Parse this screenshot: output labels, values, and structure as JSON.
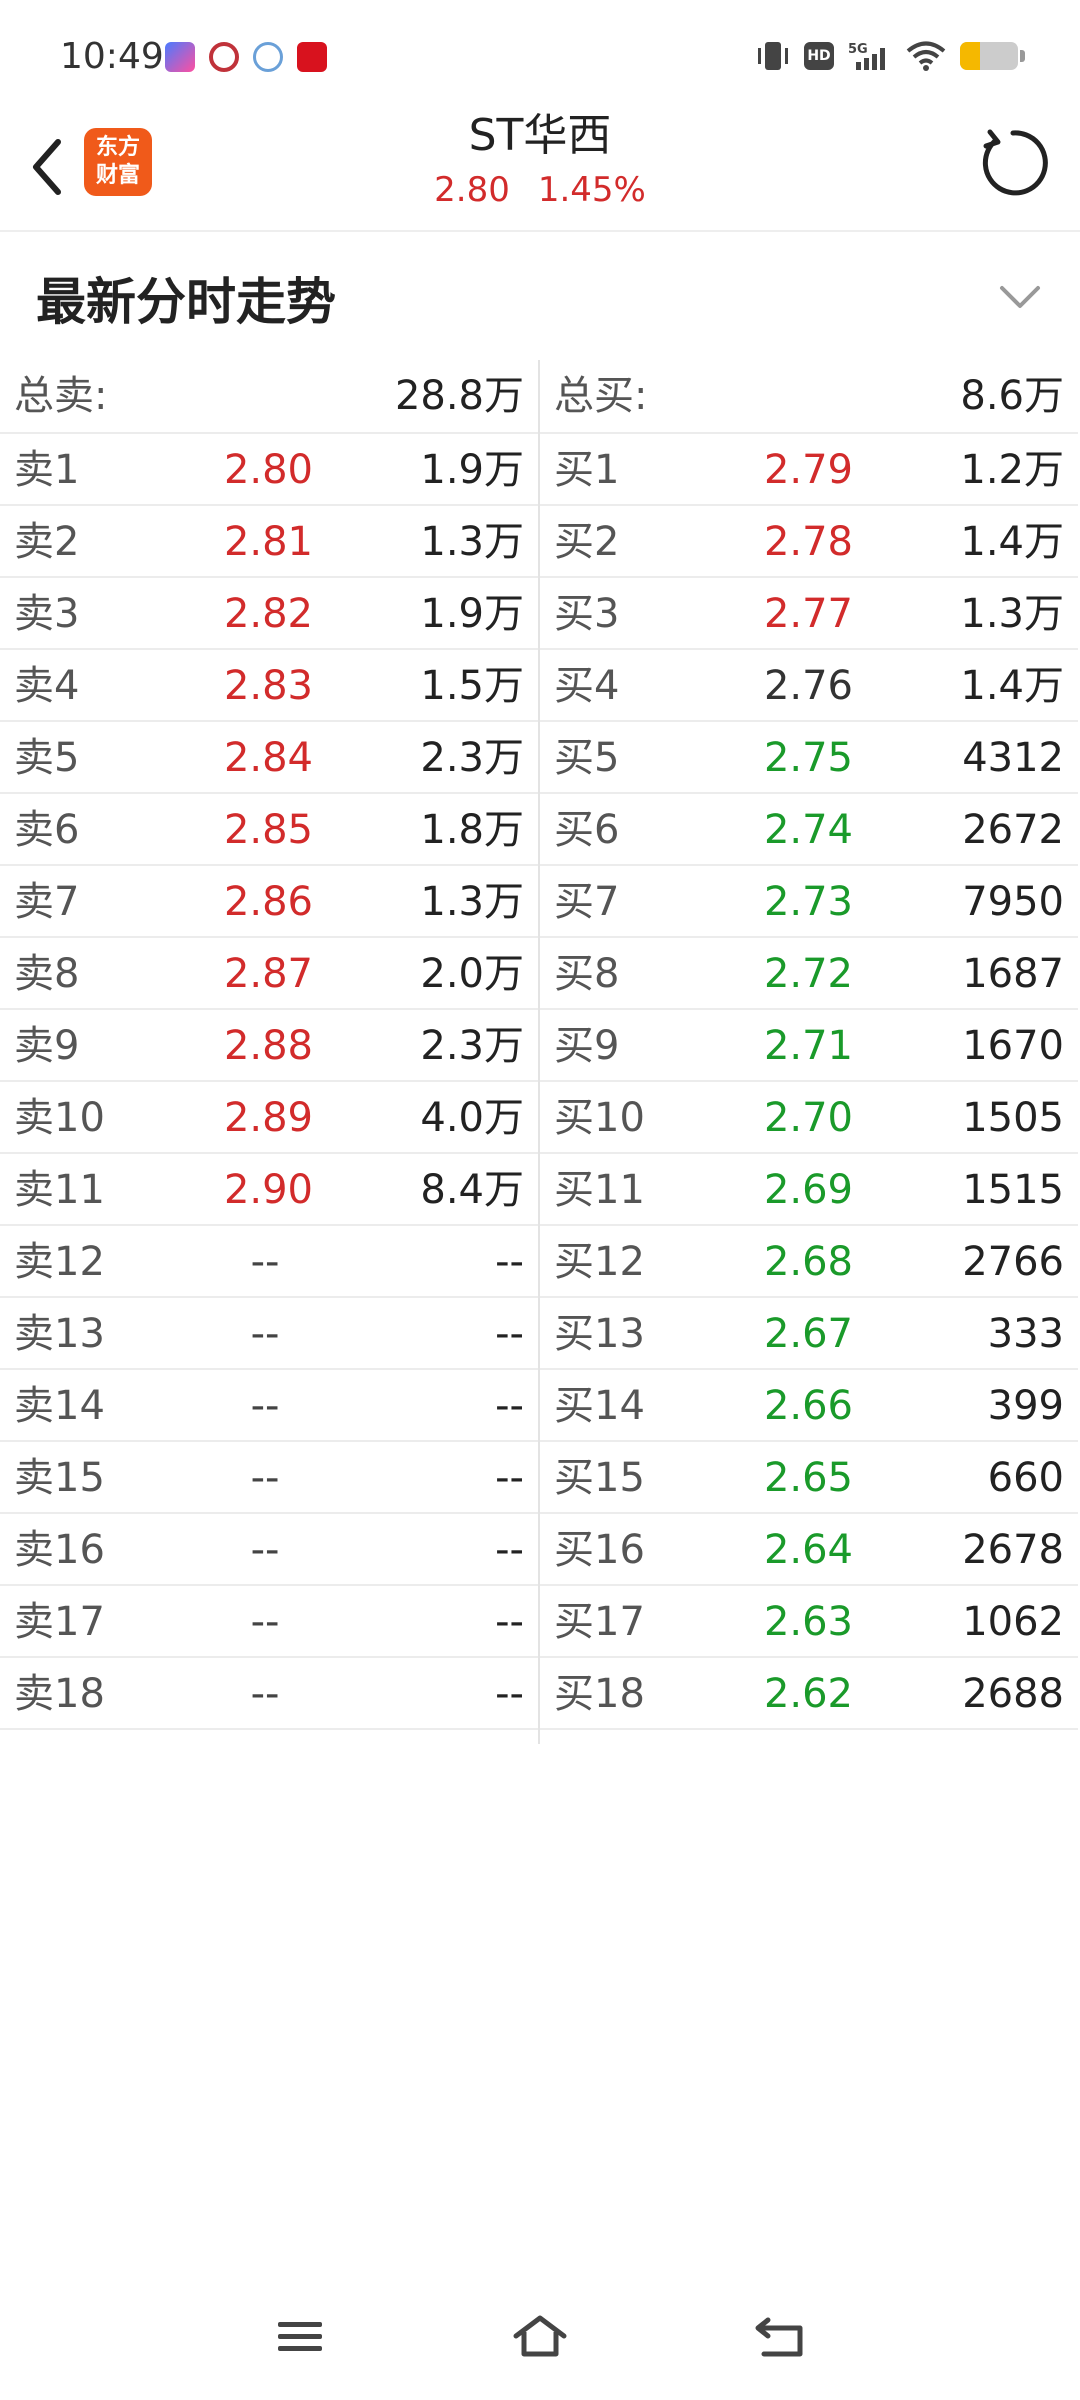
{
  "status_bar": {
    "time": "10:49",
    "network": "5G",
    "battery_level": 0.35
  },
  "header": {
    "app_logo_line1": "东方",
    "app_logo_line2": "财富",
    "stock_name": "ST华西",
    "price": "2.80",
    "change_pct": "1.45%"
  },
  "section": {
    "title": "最新分时走势"
  },
  "colors": {
    "up": "#d22b2b",
    "down": "#1a9a2a",
    "neutral": "#333333",
    "logo": "#f05a1a"
  },
  "book": {
    "sell_total_label": "总卖:",
    "sell_total": "28.8万",
    "buy_total_label": "总买:",
    "buy_total": "8.6万",
    "sell": [
      {
        "label": "卖1",
        "price": "2.80",
        "vol": "1.9万",
        "color": "red"
      },
      {
        "label": "卖2",
        "price": "2.81",
        "vol": "1.3万",
        "color": "red"
      },
      {
        "label": "卖3",
        "price": "2.82",
        "vol": "1.9万",
        "color": "red"
      },
      {
        "label": "卖4",
        "price": "2.83",
        "vol": "1.5万",
        "color": "red"
      },
      {
        "label": "卖5",
        "price": "2.84",
        "vol": "2.3万",
        "color": "red"
      },
      {
        "label": "卖6",
        "price": "2.85",
        "vol": "1.8万",
        "color": "red"
      },
      {
        "label": "卖7",
        "price": "2.86",
        "vol": "1.3万",
        "color": "red"
      },
      {
        "label": "卖8",
        "price": "2.87",
        "vol": "2.0万",
        "color": "red"
      },
      {
        "label": "卖9",
        "price": "2.88",
        "vol": "2.3万",
        "color": "red"
      },
      {
        "label": "卖10",
        "price": "2.89",
        "vol": "4.0万",
        "color": "red"
      },
      {
        "label": "卖11",
        "price": "2.90",
        "vol": "8.4万",
        "color": "red"
      },
      {
        "label": "卖12",
        "price": "--",
        "vol": "--",
        "color": "dash"
      },
      {
        "label": "卖13",
        "price": "--",
        "vol": "--",
        "color": "dash"
      },
      {
        "label": "卖14",
        "price": "--",
        "vol": "--",
        "color": "dash"
      },
      {
        "label": "卖15",
        "price": "--",
        "vol": "--",
        "color": "dash"
      },
      {
        "label": "卖16",
        "price": "--",
        "vol": "--",
        "color": "dash"
      },
      {
        "label": "卖17",
        "price": "--",
        "vol": "--",
        "color": "dash"
      },
      {
        "label": "卖18",
        "price": "--",
        "vol": "--",
        "color": "dash"
      }
    ],
    "buy": [
      {
        "label": "买1",
        "price": "2.79",
        "vol": "1.2万",
        "color": "red"
      },
      {
        "label": "买2",
        "price": "2.78",
        "vol": "1.4万",
        "color": "red"
      },
      {
        "label": "买3",
        "price": "2.77",
        "vol": "1.3万",
        "color": "red"
      },
      {
        "label": "买4",
        "price": "2.76",
        "vol": "1.4万",
        "color": "dark"
      },
      {
        "label": "买5",
        "price": "2.75",
        "vol": "4312",
        "color": "green"
      },
      {
        "label": "买6",
        "price": "2.74",
        "vol": "2672",
        "color": "green"
      },
      {
        "label": "买7",
        "price": "2.73",
        "vol": "7950",
        "color": "green"
      },
      {
        "label": "买8",
        "price": "2.72",
        "vol": "1687",
        "color": "green"
      },
      {
        "label": "买9",
        "price": "2.71",
        "vol": "1670",
        "color": "green"
      },
      {
        "label": "买10",
        "price": "2.70",
        "vol": "1505",
        "color": "green"
      },
      {
        "label": "买11",
        "price": "2.69",
        "vol": "1515",
        "color": "green"
      },
      {
        "label": "买12",
        "price": "2.68",
        "vol": "2766",
        "color": "green"
      },
      {
        "label": "买13",
        "price": "2.67",
        "vol": "333",
        "color": "green"
      },
      {
        "label": "买14",
        "price": "2.66",
        "vol": "399",
        "color": "green"
      },
      {
        "label": "买15",
        "price": "2.65",
        "vol": "660",
        "color": "green"
      },
      {
        "label": "买16",
        "price": "2.64",
        "vol": "2678",
        "color": "green"
      },
      {
        "label": "买17",
        "price": "2.63",
        "vol": "1062",
        "color": "green"
      },
      {
        "label": "买18",
        "price": "2.62",
        "vol": "2688",
        "color": "green"
      }
    ]
  }
}
